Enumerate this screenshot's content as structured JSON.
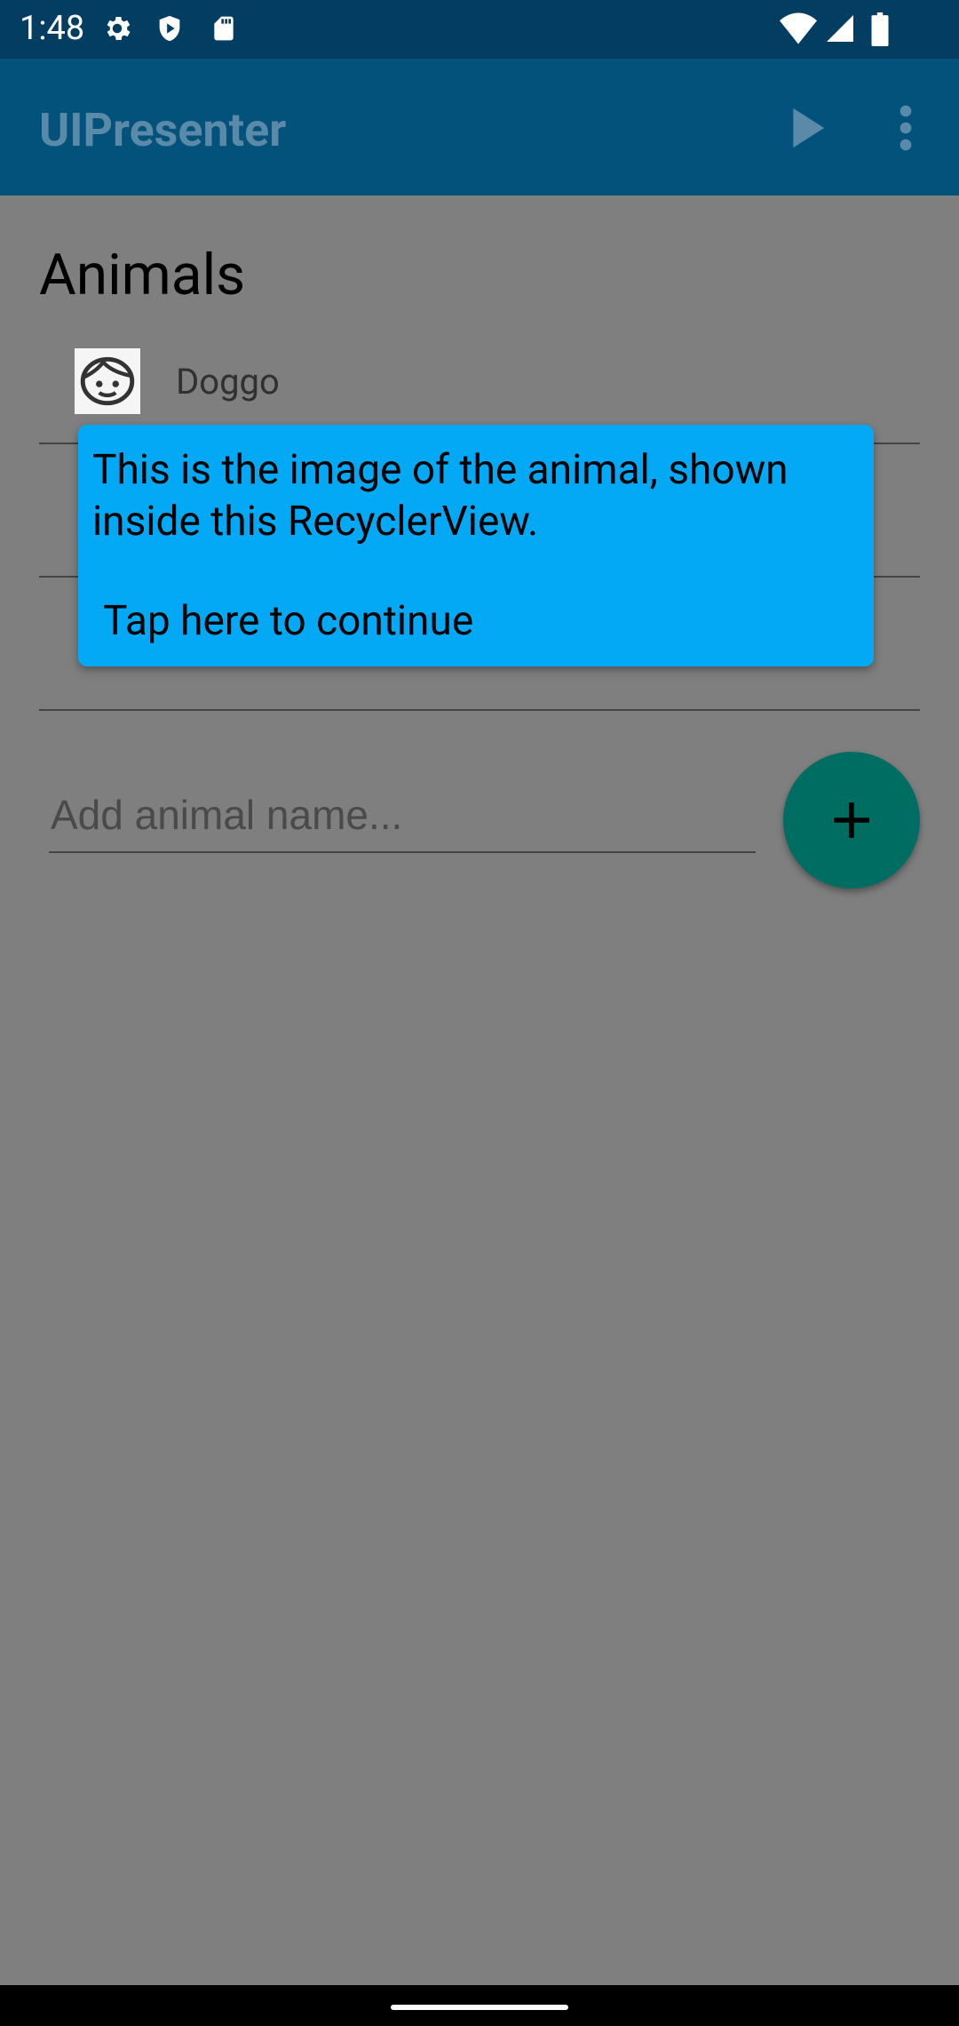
{
  "status_bar": {
    "time": "1:48",
    "icons": [
      "gear-icon",
      "shield-icon",
      "sd-card-icon",
      "wifi-icon",
      "signal-icon",
      "battery-icon"
    ]
  },
  "app_bar": {
    "title": "UIPresenter",
    "actions": [
      "play-icon",
      "more-vert-icon"
    ]
  },
  "content": {
    "section_title": "Animals",
    "items": [
      {
        "label": "Doggo",
        "icon": "face-icon"
      }
    ],
    "input": {
      "placeholder": "Add animal name..."
    },
    "fab_icon": "plus-icon"
  },
  "tooltip": {
    "message": "This is the image of the animal, shown inside this RecyclerView.",
    "action": "Tap here to continue"
  },
  "colors": {
    "status_bar": "#033e62",
    "app_bar": "#03527b",
    "tooltip": "#03a9f4",
    "fab": "#006d63",
    "scrim": "#7f7f7f"
  }
}
